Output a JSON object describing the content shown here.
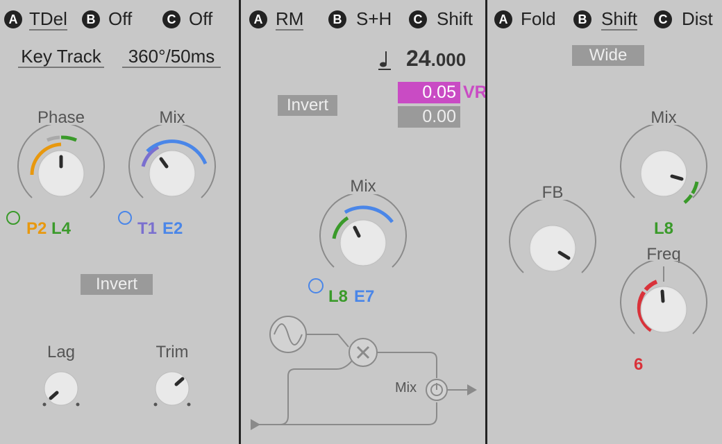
{
  "panel1": {
    "slots": [
      {
        "letter": "A",
        "label": "TDel"
      },
      {
        "letter": "B",
        "label": "Off"
      },
      {
        "letter": "C",
        "label": "Off"
      }
    ],
    "key_track": "Key Track",
    "rate": "360°/50ms",
    "phase_label": "Phase",
    "mix_label": "Mix",
    "phase_mods": [
      "P2",
      "L4"
    ],
    "mix_mods": [
      "T1",
      "E2"
    ],
    "invert_label": "Invert",
    "lag_label": "Lag",
    "trim_label": "Trim"
  },
  "panel2": {
    "slots": [
      {
        "letter": "A",
        "label": "RM"
      },
      {
        "letter": "B",
        "label": "S+H"
      },
      {
        "letter": "C",
        "label": "Shift"
      }
    ],
    "note_icon": "quarter-note-icon",
    "tempo_int": "24",
    "tempo_frac": ".000",
    "value_top": "0.05",
    "value_bottom": "0.00",
    "vr_label": "VR",
    "invert_label": "Invert",
    "mix_label": "Mix",
    "mix_mods": [
      "L8",
      "E7"
    ],
    "diagram_mix_label": "Mix"
  },
  "panel3": {
    "slots": [
      {
        "letter": "A",
        "label": "Fold"
      },
      {
        "letter": "B",
        "label": "Shift"
      },
      {
        "letter": "C",
        "label": "Dist"
      }
    ],
    "wide_label": "Wide",
    "mix_label": "Mix",
    "fb_label": "FB",
    "mix_mod": "L8",
    "freq_label": "Freq",
    "freq_mod": "6"
  },
  "colors": {
    "orange": "#e8980e",
    "green": "#3a9a2a",
    "blue": "#4a86e8",
    "purple": "#7a6fcf",
    "magenta": "#c94bc4",
    "red": "#d9323a"
  }
}
